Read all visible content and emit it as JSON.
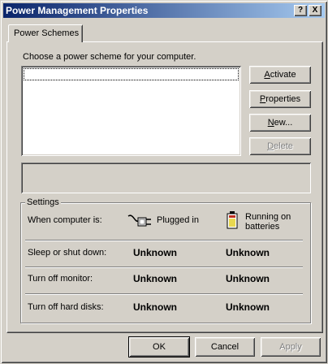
{
  "window": {
    "title": "Power Management Properties",
    "help_label": "?",
    "close_label": "X"
  },
  "tab": {
    "label": "Power Schemes"
  },
  "scheme": {
    "prompt": "Choose a power scheme for your computer.",
    "buttons": {
      "activate": {
        "first": "A",
        "rest": "ctivate"
      },
      "properties": {
        "first": "P",
        "rest": "roperties"
      },
      "new": {
        "first": "N",
        "rest": "ew..."
      },
      "delete": {
        "first": "D",
        "rest": "elete"
      }
    }
  },
  "settings": {
    "title": "Settings",
    "when_label": "When computer is:",
    "plugged_in": "Plugged in",
    "batteries_line1": "Running on",
    "batteries_line2": "batteries",
    "rows": [
      {
        "label": "Sleep or shut down:",
        "plugged": "Unknown",
        "battery": "Unknown"
      },
      {
        "label": "Turn off monitor:",
        "plugged": "Unknown",
        "battery": "Unknown"
      },
      {
        "label": "Turn off hard disks:",
        "plugged": "Unknown",
        "battery": "Unknown"
      }
    ]
  },
  "footer": {
    "ok": "OK",
    "cancel": "Cancel",
    "apply": "Apply"
  },
  "colors": {
    "titlebar_start": "#0a246a",
    "titlebar_end": "#a6caf0",
    "face": "#d4d0c8"
  },
  "icons": [
    "help-icon",
    "close-icon",
    "plug-icon",
    "battery-icon"
  ]
}
